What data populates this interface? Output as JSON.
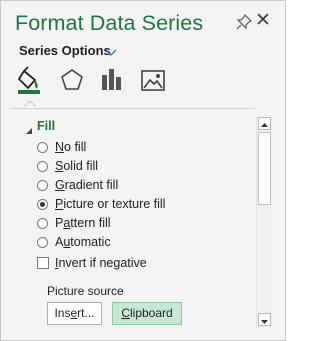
{
  "panel": {
    "title": "Format Data Series",
    "series_options_label": "Series Options",
    "icons": [
      "pin-icon",
      "close-icon",
      "fill-line-icon",
      "effects-icon",
      "series-options-icon",
      "picture-icon"
    ]
  },
  "fill": {
    "section_label": "Fill",
    "options": [
      {
        "pre": "",
        "u": "N",
        "post": "o fill",
        "selected": false
      },
      {
        "pre": "",
        "u": "S",
        "post": "olid fill",
        "selected": false
      },
      {
        "pre": "",
        "u": "G",
        "post": "radient fill",
        "selected": false
      },
      {
        "pre": "",
        "u": "P",
        "post": "icture or texture fill",
        "selected": true
      },
      {
        "pre": "P",
        "u": "a",
        "post": "ttern fill",
        "selected": false
      },
      {
        "pre": "A",
        "u": "u",
        "post": "tomatic",
        "selected": false
      }
    ],
    "invert": {
      "pre": "",
      "u": "I",
      "post": "nvert if negative",
      "checked": false
    },
    "picture_source_label": "Picture source",
    "insert_pre": "Ins",
    "insert_u": "e",
    "insert_post": "rt...",
    "clipboard_pre": "",
    "clipboard_u": "C",
    "clipboard_post": "lipboard"
  },
  "colors": {
    "accent": "#217346",
    "selected_button": "#c6e7d3"
  }
}
